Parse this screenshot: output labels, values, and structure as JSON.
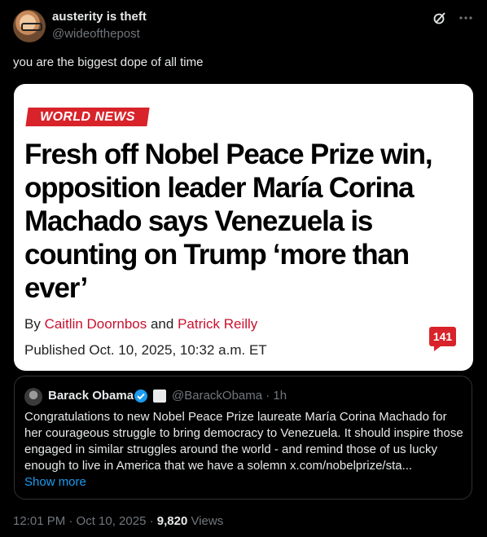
{
  "author": {
    "name": "austerity is theft",
    "handle": "@wideofthepost"
  },
  "tweet": {
    "text": "you are the biggest dope of all time"
  },
  "article": {
    "label": "WORLD NEWS",
    "headline": "Fresh off Nobel Peace Prize win, opposition leader María Corina Machado says Venezuela is counting on Trump ‘more than ever’",
    "by_prefix": "By ",
    "author1": "Caitlin Doornbos",
    "and_text": " and ",
    "author2": "Patrick Reilly",
    "published": "Published Oct. 10, 2025, 10:32 a.m. ET",
    "comment_count": "141"
  },
  "quote": {
    "name": "Barack Obama",
    "meta": "@BarackObama · 1h",
    "text": "Congratulations to new Nobel Peace Prize laureate María Corina Machado for her courageous struggle to bring democracy to Venezuela. It should inspire those engaged in similar struggles around the world - and remind those of us lucky enough to live in America that we have a solemn x.com/nobelprize/sta...",
    "show_more": "Show more"
  },
  "footer": {
    "time": "12:01 PM · Oct 10, 2025 · ",
    "views_count": "9,820",
    "views_label": " Views"
  },
  "colors": {
    "accent_blue": "#1d9bf0",
    "news_red": "#d8232a",
    "author_red": "#c8102e"
  },
  "icons": [
    "grok-icon",
    "more-icon",
    "verified-badge-icon",
    "flag-icon"
  ]
}
